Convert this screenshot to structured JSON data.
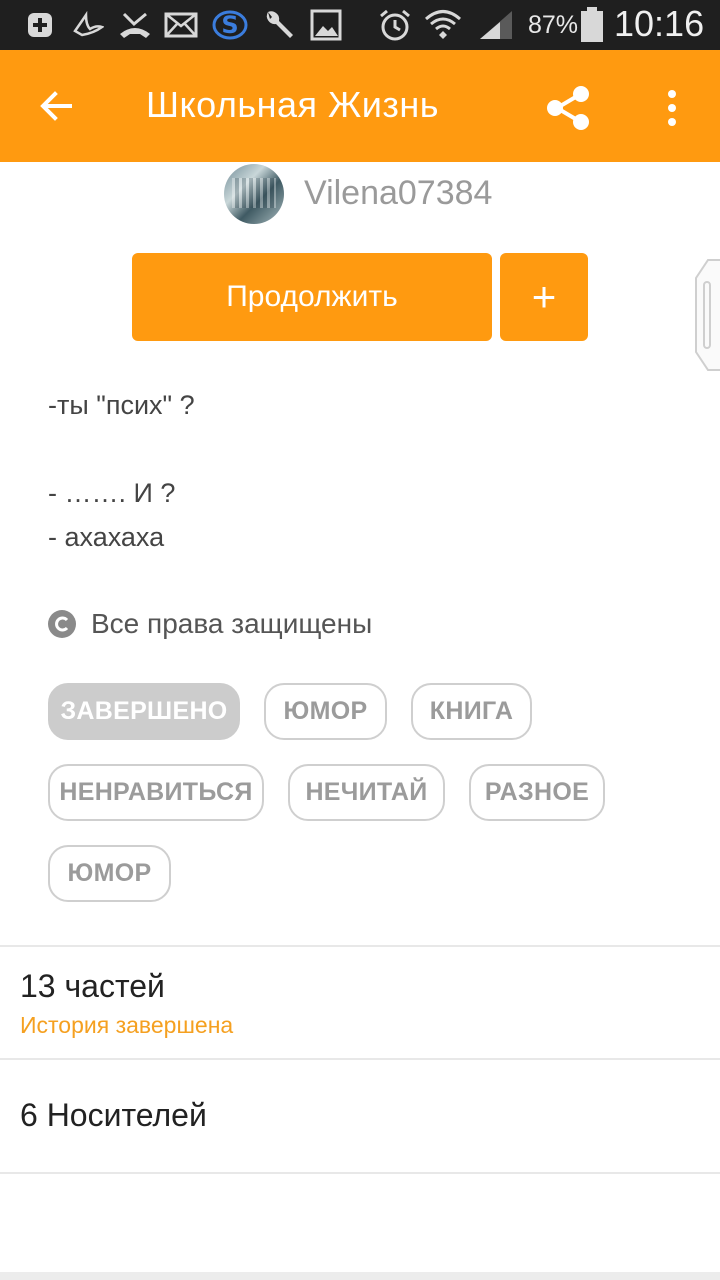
{
  "status_bar": {
    "icons": [
      "add-box-icon",
      "swallow-icon",
      "missed-call-icon",
      "mail-icon",
      "s-logo-icon",
      "wrench-icon",
      "image-icon",
      "alarm-icon",
      "wifi-icon",
      "signal-icon",
      "battery-icon"
    ],
    "battery": "87%",
    "time": "10:16"
  },
  "toolbar": {
    "title": "Школьная Жизнь",
    "back_icon": "arrow-back-icon",
    "share_icon": "share-icon",
    "more_icon": "more-vert-icon",
    "color": "#ff9a10"
  },
  "author": {
    "name": "Vilena07384"
  },
  "actions": {
    "continue_label": "Продолжить",
    "add_label": "+"
  },
  "description": {
    "lines": [
      "-ты \"псих\" ?",
      "",
      "- ……. И ?",
      "- ахахаха"
    ]
  },
  "copyright": {
    "text": "Все права защищены"
  },
  "tags": [
    {
      "label": "ЗАВЕРШЕНО",
      "status": true
    },
    {
      "label": "ЮМОР"
    },
    {
      "label": "КНИГА"
    },
    {
      "label": "НЕНРАВИТЬСЯ"
    },
    {
      "label": "НЕЧИТАЙ"
    },
    {
      "label": "РАЗНОЕ"
    },
    {
      "label": "ЮМОР"
    }
  ],
  "parts": {
    "count": "13 частей",
    "status": "История завершена"
  },
  "carriers": {
    "label": "6 Носителей"
  },
  "colors": {
    "accent": "#ff9a10",
    "status_text": "#f5a020",
    "tag_done_bg": "#cccccc"
  }
}
